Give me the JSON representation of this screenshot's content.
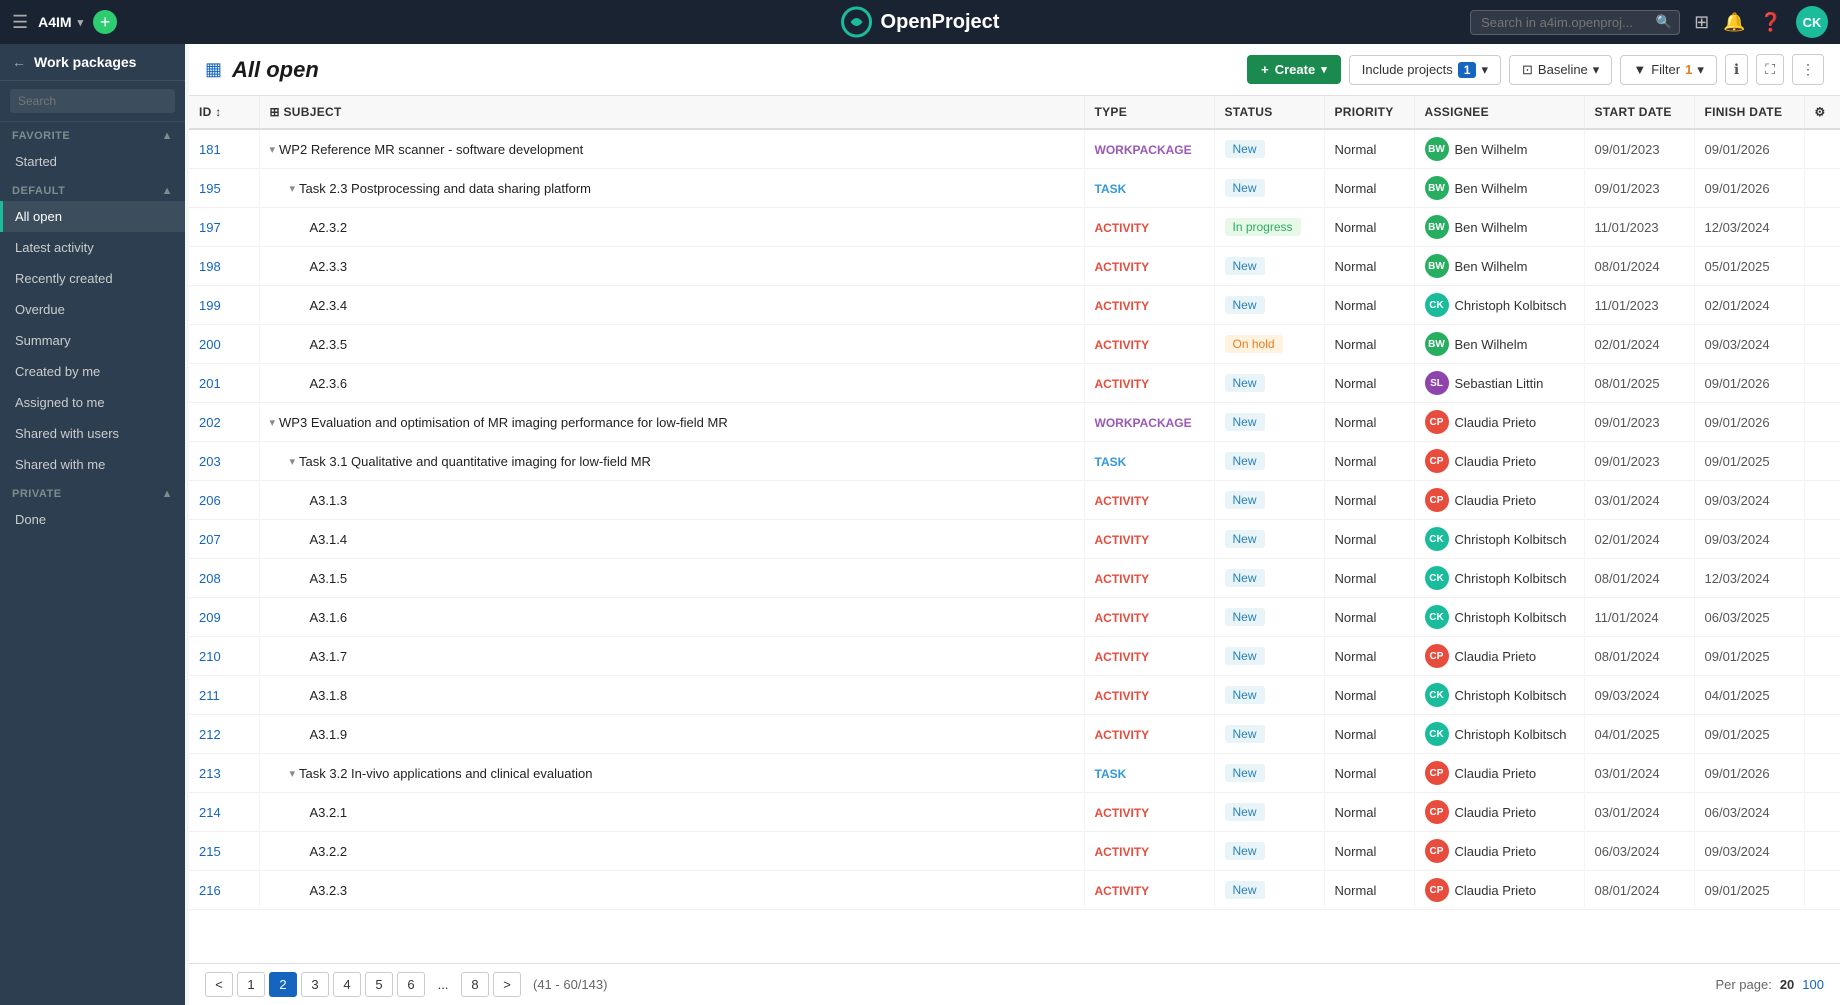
{
  "topnav": {
    "brand": "A4IM",
    "logo_text": "OpenProject",
    "search_placeholder": "Search in a4im.openproj...",
    "avatar_initials": "CK"
  },
  "sidebar": {
    "title": "Work packages",
    "search_placeholder": "Search",
    "favorite_section": "FAVORITE",
    "favorite_items": [
      {
        "id": "started",
        "label": "Started"
      }
    ],
    "default_section": "DEFAULT",
    "default_items": [
      {
        "id": "all-open",
        "label": "All open",
        "active": true
      },
      {
        "id": "latest-activity",
        "label": "Latest activity"
      },
      {
        "id": "recently-created",
        "label": "Recently created"
      },
      {
        "id": "overdue",
        "label": "Overdue"
      },
      {
        "id": "summary",
        "label": "Summary"
      },
      {
        "id": "created-by-me",
        "label": "Created by me"
      },
      {
        "id": "assigned-to-me",
        "label": "Assigned to me"
      },
      {
        "id": "shared-with-users",
        "label": "Shared with users"
      },
      {
        "id": "shared-with-me",
        "label": "Shared with me"
      }
    ],
    "private_section": "PRIVATE",
    "private_items": [
      {
        "id": "done",
        "label": "Done"
      }
    ]
  },
  "toolbar": {
    "page_title": "All open",
    "create_label": "Create",
    "include_projects_label": "Include projects",
    "include_projects_count": "1",
    "baseline_label": "Baseline",
    "filter_label": "Filter",
    "filter_count": "1"
  },
  "table": {
    "columns": [
      {
        "id": "id",
        "label": "ID"
      },
      {
        "id": "subject",
        "label": "Subject"
      },
      {
        "id": "type",
        "label": "Type"
      },
      {
        "id": "status",
        "label": "Status"
      },
      {
        "id": "priority",
        "label": "Priority"
      },
      {
        "id": "assignee",
        "label": "Assignee"
      },
      {
        "id": "start_date",
        "label": "Start Date"
      },
      {
        "id": "finish_date",
        "label": "Finish Date"
      },
      {
        "id": "settings",
        "label": "⚙"
      }
    ],
    "rows": [
      {
        "id": "181",
        "level": 0,
        "expand": true,
        "subject": "WP2 Reference MR scanner - software development",
        "type": "WORKPACKAGE",
        "status": "New",
        "priority": "Normal",
        "assignee": "Ben Wilhelm",
        "assignee_initials": "BW",
        "assignee_color": "#27ae60",
        "start_date": "09/01/2023",
        "finish_date": "09/01/2026"
      },
      {
        "id": "195",
        "level": 1,
        "expand": true,
        "subject": "Task 2.3 Postprocessing and data sharing platform",
        "type": "TASK",
        "status": "New",
        "priority": "Normal",
        "assignee": "Ben Wilhelm",
        "assignee_initials": "BW",
        "assignee_color": "#27ae60",
        "start_date": "09/01/2023",
        "finish_date": "09/01/2026"
      },
      {
        "id": "197",
        "level": 2,
        "expand": false,
        "subject": "A2.3.2",
        "type": "ACTIVITY",
        "status": "In progress",
        "priority": "Normal",
        "assignee": "Ben Wilhelm",
        "assignee_initials": "BW",
        "assignee_color": "#27ae60",
        "start_date": "11/01/2023",
        "finish_date": "12/03/2024"
      },
      {
        "id": "198",
        "level": 2,
        "expand": false,
        "subject": "A2.3.3",
        "type": "ACTIVITY",
        "status": "New",
        "priority": "Normal",
        "assignee": "Ben Wilhelm",
        "assignee_initials": "BW",
        "assignee_color": "#27ae60",
        "start_date": "08/01/2024",
        "finish_date": "05/01/2025"
      },
      {
        "id": "199",
        "level": 2,
        "expand": false,
        "subject": "A2.3.4",
        "type": "ACTIVITY",
        "status": "New",
        "priority": "Normal",
        "assignee": "Christoph Kolbitsch",
        "assignee_initials": "CK",
        "assignee_color": "#1abc9c",
        "start_date": "11/01/2023",
        "finish_date": "02/01/2024"
      },
      {
        "id": "200",
        "level": 2,
        "expand": false,
        "subject": "A2.3.5",
        "type": "ACTIVITY",
        "status": "On hold",
        "priority": "Normal",
        "assignee": "Ben Wilhelm",
        "assignee_initials": "BW",
        "assignee_color": "#27ae60",
        "start_date": "02/01/2024",
        "finish_date": "09/03/2024"
      },
      {
        "id": "201",
        "level": 2,
        "expand": false,
        "subject": "A2.3.6",
        "type": "ACTIVITY",
        "status": "New",
        "priority": "Normal",
        "assignee": "Sebastian Littin",
        "assignee_initials": "SL",
        "assignee_color": "#8e44ad",
        "start_date": "08/01/2025",
        "finish_date": "09/01/2026"
      },
      {
        "id": "202",
        "level": 0,
        "expand": true,
        "subject": "WP3 Evaluation and optimisation of MR imaging performance for low-field MR",
        "type": "WORKPACKAGE",
        "status": "New",
        "priority": "Normal",
        "assignee": "Claudia Prieto",
        "assignee_initials": "CP",
        "assignee_color": "#e74c3c",
        "start_date": "09/01/2023",
        "finish_date": "09/01/2026"
      },
      {
        "id": "203",
        "level": 1,
        "expand": true,
        "subject": "Task 3.1 Qualitative and quantitative imaging for low-field MR",
        "type": "TASK",
        "status": "New",
        "priority": "Normal",
        "assignee": "Claudia Prieto",
        "assignee_initials": "CP",
        "assignee_color": "#e74c3c",
        "start_date": "09/01/2023",
        "finish_date": "09/01/2025"
      },
      {
        "id": "206",
        "level": 2,
        "expand": false,
        "subject": "A3.1.3",
        "type": "ACTIVITY",
        "status": "New",
        "priority": "Normal",
        "assignee": "Claudia Prieto",
        "assignee_initials": "CP",
        "assignee_color": "#e74c3c",
        "start_date": "03/01/2024",
        "finish_date": "09/03/2024"
      },
      {
        "id": "207",
        "level": 2,
        "expand": false,
        "subject": "A3.1.4",
        "type": "ACTIVITY",
        "status": "New",
        "priority": "Normal",
        "assignee": "Christoph Kolbitsch",
        "assignee_initials": "CK",
        "assignee_color": "#1abc9c",
        "start_date": "02/01/2024",
        "finish_date": "09/03/2024"
      },
      {
        "id": "208",
        "level": 2,
        "expand": false,
        "subject": "A3.1.5",
        "type": "ACTIVITY",
        "status": "New",
        "priority": "Normal",
        "assignee": "Christoph Kolbitsch",
        "assignee_initials": "CK",
        "assignee_color": "#1abc9c",
        "start_date": "08/01/2024",
        "finish_date": "12/03/2024"
      },
      {
        "id": "209",
        "level": 2,
        "expand": false,
        "subject": "A3.1.6",
        "type": "ACTIVITY",
        "status": "New",
        "priority": "Normal",
        "assignee": "Christoph Kolbitsch",
        "assignee_initials": "CK",
        "assignee_color": "#1abc9c",
        "start_date": "11/01/2024",
        "finish_date": "06/03/2025"
      },
      {
        "id": "210",
        "level": 2,
        "expand": false,
        "subject": "A3.1.7",
        "type": "ACTIVITY",
        "status": "New",
        "priority": "Normal",
        "assignee": "Claudia Prieto",
        "assignee_initials": "CP",
        "assignee_color": "#e74c3c",
        "start_date": "08/01/2024",
        "finish_date": "09/01/2025"
      },
      {
        "id": "211",
        "level": 2,
        "expand": false,
        "subject": "A3.1.8",
        "type": "ACTIVITY",
        "status": "New",
        "priority": "Normal",
        "assignee": "Christoph Kolbitsch",
        "assignee_initials": "CK",
        "assignee_color": "#1abc9c",
        "start_date": "09/03/2024",
        "finish_date": "04/01/2025"
      },
      {
        "id": "212",
        "level": 2,
        "expand": false,
        "subject": "A3.1.9",
        "type": "ACTIVITY",
        "status": "New",
        "priority": "Normal",
        "assignee": "Christoph Kolbitsch",
        "assignee_initials": "CK",
        "assignee_color": "#1abc9c",
        "start_date": "04/01/2025",
        "finish_date": "09/01/2025"
      },
      {
        "id": "213",
        "level": 1,
        "expand": true,
        "subject": "Task 3.2 In-vivo applications and clinical evaluation",
        "type": "TASK",
        "status": "New",
        "priority": "Normal",
        "assignee": "Claudia Prieto",
        "assignee_initials": "CP",
        "assignee_color": "#e74c3c",
        "start_date": "03/01/2024",
        "finish_date": "09/01/2026"
      },
      {
        "id": "214",
        "level": 2,
        "expand": false,
        "subject": "A3.2.1",
        "type": "ACTIVITY",
        "status": "New",
        "priority": "Normal",
        "assignee": "Claudia Prieto",
        "assignee_initials": "CP",
        "assignee_color": "#e74c3c",
        "start_date": "03/01/2024",
        "finish_date": "06/03/2024"
      },
      {
        "id": "215",
        "level": 2,
        "expand": false,
        "subject": "A3.2.2",
        "type": "ACTIVITY",
        "status": "New",
        "priority": "Normal",
        "assignee": "Claudia Prieto",
        "assignee_initials": "CP",
        "assignee_color": "#e74c3c",
        "start_date": "06/03/2024",
        "finish_date": "09/03/2024"
      },
      {
        "id": "216",
        "level": 2,
        "expand": false,
        "subject": "A3.2.3",
        "type": "ACTIVITY",
        "status": "New",
        "priority": "Normal",
        "assignee": "Claudia Prieto",
        "assignee_initials": "CP",
        "assignee_color": "#e74c3c",
        "start_date": "08/01/2024",
        "finish_date": "09/01/2025"
      }
    ]
  },
  "pagination": {
    "pages": [
      "<",
      "1",
      "2",
      "3",
      "4",
      "5",
      "6",
      "...",
      "8",
      ">"
    ],
    "current_page": "2",
    "range_info": "(41 - 60/143)",
    "per_page_label": "Per page:",
    "per_page_options": [
      "20",
      "100"
    ],
    "per_page_active": "20"
  }
}
